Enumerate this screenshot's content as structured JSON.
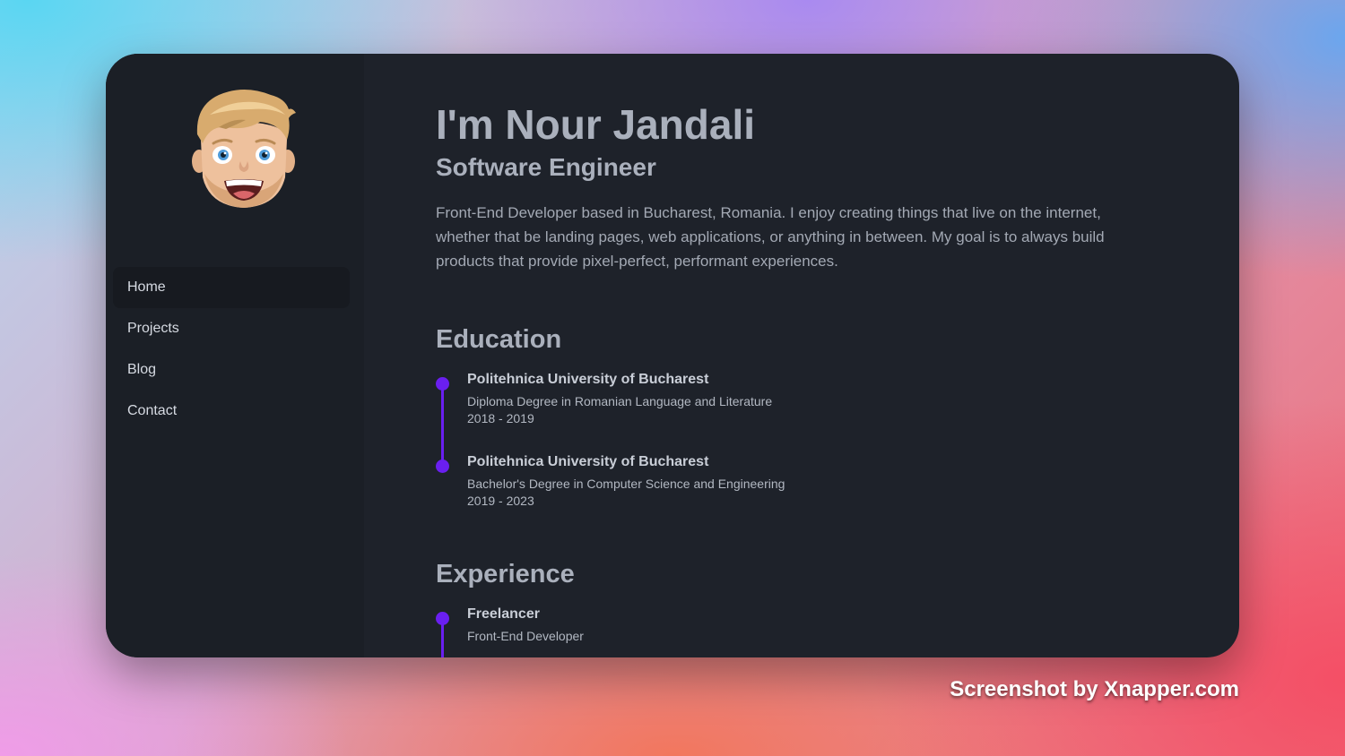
{
  "sidebar": {
    "nav": [
      {
        "label": "Home",
        "active": true
      },
      {
        "label": "Projects",
        "active": false
      },
      {
        "label": "Blog",
        "active": false
      },
      {
        "label": "Contact",
        "active": false
      }
    ]
  },
  "main": {
    "name": "I'm Nour Jandali",
    "role": "Software Engineer",
    "bio": "Front-End Developer based in Bucharest, Romania. I enjoy creating things that live on the internet, whether that be landing pages, web applications, or anything in between. My goal is to always build products that provide pixel-perfect, performant experiences.",
    "education": {
      "title": "Education",
      "items": [
        {
          "school": "Politehnica University of Bucharest",
          "degree": "Diploma Degree in Romanian Language and Literature",
          "years": "2018 - 2019"
        },
        {
          "school": "Politehnica University of Bucharest",
          "degree": "Bachelor's Degree in Computer Science and Engineering",
          "years": "2019 - 2023"
        }
      ]
    },
    "experience": {
      "title": "Experience",
      "items": [
        {
          "title": "Freelancer",
          "role": "Front-End Developer"
        }
      ]
    }
  },
  "colors": {
    "accent": "#6a1ff0",
    "window_bg": "#1e222a",
    "sidebar_bg": "#1b1f26"
  },
  "credit": "Screenshot by Xnapper.com"
}
